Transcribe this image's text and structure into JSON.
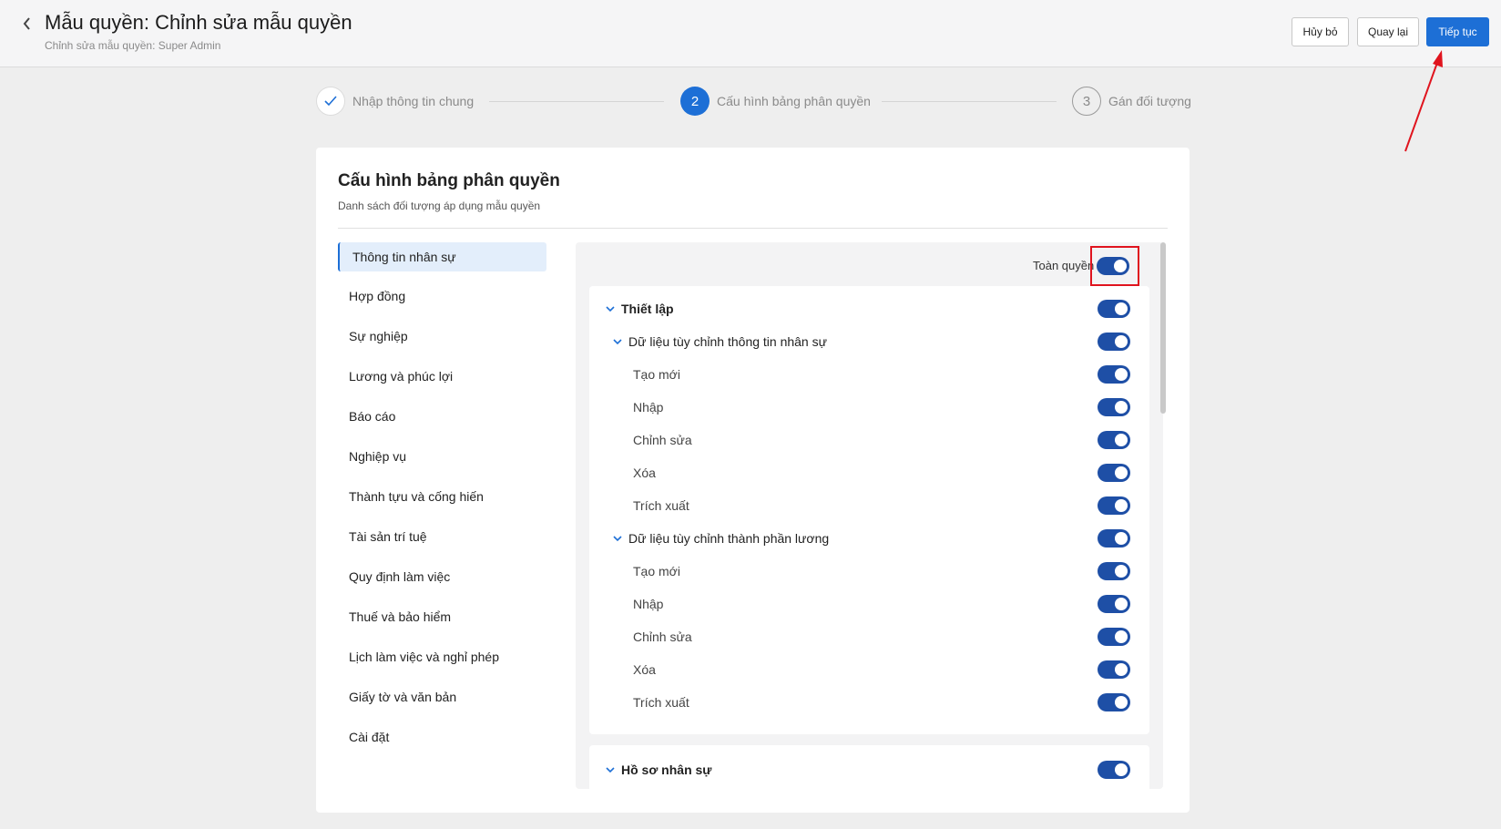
{
  "header": {
    "title": "Mẫu quyền: Chỉnh sửa mẫu quyền",
    "subtitle": "Chỉnh sửa mẫu quyền: Super Admin",
    "buttons": {
      "cancel": "Hủy bỏ",
      "back": "Quay lại",
      "continue": "Tiếp tục"
    }
  },
  "stepper": [
    {
      "label": "Nhập thông tin chung",
      "state": "done",
      "number": ""
    },
    {
      "label": "Cấu hình bảng phân quyền",
      "state": "active",
      "number": "2"
    },
    {
      "label": "Gán đối tượng",
      "state": "pending",
      "number": "3"
    }
  ],
  "card": {
    "title": "Cấu hình bảng phân quyền",
    "subtitle": "Danh sách đối tượng áp dụng mẫu quyền"
  },
  "categories": [
    {
      "label": "Thông tin nhân sự",
      "active": true
    },
    {
      "label": "Hợp đồng",
      "active": false
    },
    {
      "label": "Sự nghiệp",
      "active": false
    },
    {
      "label": "Lương và phúc lợi",
      "active": false
    },
    {
      "label": "Báo cáo",
      "active": false
    },
    {
      "label": "Nghiệp vụ",
      "active": false
    },
    {
      "label": "Thành tựu và cống hiến",
      "active": false
    },
    {
      "label": "Tài sản trí tuệ",
      "active": false
    },
    {
      "label": "Quy định làm việc",
      "active": false
    },
    {
      "label": "Thuế và bảo hiểm",
      "active": false
    },
    {
      "label": "Lịch làm việc và nghỉ phép",
      "active": false
    },
    {
      "label": "Giấy tờ và văn bản",
      "active": false
    },
    {
      "label": "Cài đặt",
      "active": false
    }
  ],
  "permissions": {
    "full_access_label": "Toàn quyền",
    "full_access_on": true,
    "group1": {
      "label": "Thiết lập",
      "on": true,
      "sections": [
        {
          "label": "Dữ liệu tùy chỉnh thông tin nhân sự",
          "on": true,
          "items": [
            {
              "label": "Tạo mới",
              "on": true
            },
            {
              "label": "Nhập",
              "on": true
            },
            {
              "label": "Chỉnh sửa",
              "on": true
            },
            {
              "label": "Xóa",
              "on": true
            },
            {
              "label": "Trích xuất",
              "on": true
            }
          ]
        },
        {
          "label": "Dữ liệu tùy chỉnh thành phần lương",
          "on": true,
          "items": [
            {
              "label": "Tạo mới",
              "on": true
            },
            {
              "label": "Nhập",
              "on": true
            },
            {
              "label": "Chỉnh sửa",
              "on": true
            },
            {
              "label": "Xóa",
              "on": true
            },
            {
              "label": "Trích xuất",
              "on": true
            }
          ]
        }
      ]
    },
    "group2": {
      "label": "Hồ sơ nhân sự",
      "on": true
    }
  },
  "colors": {
    "primary": "#1d6fd6",
    "toggle_on": "#1e4fa6",
    "annotation": "#e0141e"
  }
}
